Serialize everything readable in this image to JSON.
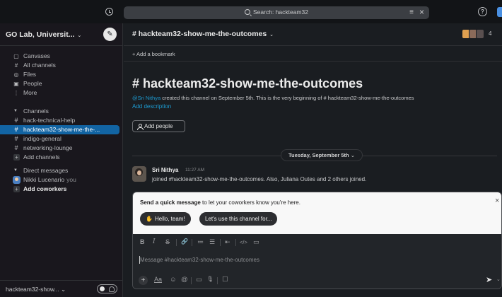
{
  "topbar": {
    "search_placeholder": "Search: hackteam32",
    "history_icon": "history-icon",
    "help_icon": "help-icon"
  },
  "sidebar": {
    "workspace_name": "GO Lab, Universit...",
    "nav": [
      {
        "label": "Canvases",
        "icon": "canvas-icon"
      },
      {
        "label": "All channels",
        "icon": "channels-icon"
      },
      {
        "label": "Files",
        "icon": "files-icon"
      },
      {
        "label": "People",
        "icon": "people-icon"
      },
      {
        "label": "More",
        "icon": "more-icon"
      }
    ],
    "channels_header": "Channels",
    "channels": [
      {
        "label": "hack-technical-help",
        "active": false
      },
      {
        "label": "hackteam32-show-me-the-...",
        "active": true
      },
      {
        "label": "indigo-general",
        "active": false
      },
      {
        "label": "networking-lounge",
        "active": false
      }
    ],
    "add_channels": "Add channels",
    "dm_header": "Direct messages",
    "dm_user": "Nikki Lucenario",
    "dm_you": "you",
    "add_coworkers": "Add coworkers",
    "footer_workspace": "hackteam32-show...",
    "footer_chevron": "⌄"
  },
  "channel": {
    "title": "# hackteam32-show-me-the-outcomes",
    "member_count": "4",
    "add_bookmark": "+ Add a bookmark",
    "intro_title": "# hackteam32-show-me-the-outcomes",
    "intro_mention": "@Sri Nithya",
    "intro_rest": " created this channel on September 5th. This is the very beginning of # hackteam32-show-me-the-outcomes",
    "add_description": "Add description",
    "add_people": "Add people",
    "day_label": "Tuesday, September 5th",
    "message": {
      "author": "Sri Nithya",
      "time": "11:27 AM",
      "text": "joined #hackteam32-show-me-the-outcomes. Also, Juliana Outes and 2 others joined."
    }
  },
  "composer": {
    "suggest_bold": "Send a quick message",
    "suggest_rest": " to let your coworkers know you're here.",
    "chip_hello": "Hello, team!",
    "chip_use": "Let's use this channel for...",
    "placeholder": "Message #hackteam32-show-me-the-outcomes",
    "format_tools": [
      "B",
      "I",
      "S",
      "🔗",
      "≔",
      "☰",
      "⇤",
      "</>",
      "▭"
    ],
    "bottom_tools": [
      "Aa",
      "☺",
      "@",
      "▭",
      "🎙",
      "☐"
    ]
  },
  "colors": {
    "active_channel": "#1264a3",
    "link": "#1d9bd1",
    "sidebar_bg": "#19171d",
    "main_bg": "#1a1d21"
  }
}
